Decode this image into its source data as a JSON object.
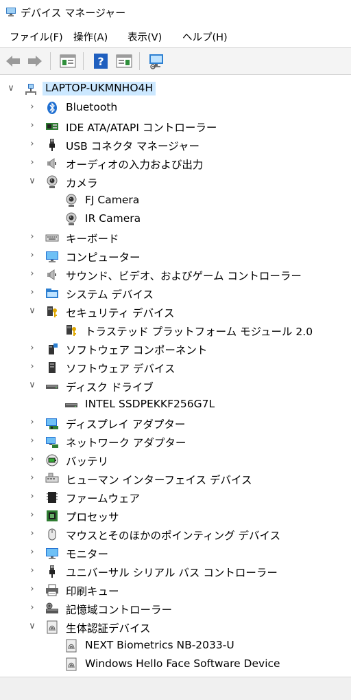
{
  "window": {
    "title": "デバイス マネージャー"
  },
  "menu": [
    {
      "label": "ファイル(F)"
    },
    {
      "label": "操作(A)"
    },
    {
      "label": "表示(V)"
    },
    {
      "label": "ヘルプ(H)"
    }
  ],
  "toolbar": [
    {
      "name": "back-button",
      "icon": "back-arrow-icon"
    },
    {
      "name": "forward-button",
      "icon": "forward-arrow-icon"
    },
    {
      "name": "show-hide-console-tree-button",
      "icon": "console-tree-icon"
    },
    {
      "name": "help-button",
      "icon": "help-icon"
    },
    {
      "name": "show-action-pane-button",
      "icon": "action-pane-icon"
    },
    {
      "name": "scan-hardware-button",
      "icon": "monitor-scan-icon"
    }
  ],
  "tree": {
    "root": {
      "label": "LAPTOP-UKMNHO4H",
      "icon": "computer-network-icon"
    },
    "items": [
      {
        "label": "Bluetooth",
        "icon": "bluetooth-icon",
        "expanded": false,
        "level": 1
      },
      {
        "label": "IDE ATA/ATAPI コントローラー",
        "icon": "ide-controller-icon",
        "expanded": false,
        "level": 1
      },
      {
        "label": "USB コネクタ マネージャー",
        "icon": "usb-plug-icon",
        "expanded": false,
        "level": 1
      },
      {
        "label": "オーディオの入力および出力",
        "icon": "speaker-icon",
        "expanded": false,
        "level": 1
      },
      {
        "label": "カメラ",
        "icon": "webcam-icon",
        "expanded": true,
        "level": 1
      },
      {
        "label": "FJ Camera",
        "icon": "webcam-icon",
        "level": 2
      },
      {
        "label": "IR Camera",
        "icon": "webcam-icon",
        "level": 2
      },
      {
        "label": "キーボード",
        "icon": "keyboard-icon",
        "expanded": false,
        "level": 1
      },
      {
        "label": "コンピューター",
        "icon": "monitor-icon",
        "expanded": false,
        "level": 1
      },
      {
        "label": "サウンド、ビデオ、およびゲーム コントローラー",
        "icon": "speaker-icon",
        "expanded": false,
        "level": 1
      },
      {
        "label": "システム デバイス",
        "icon": "system-folder-icon",
        "expanded": false,
        "level": 1
      },
      {
        "label": "セキュリティ デバイス",
        "icon": "security-key-icon",
        "expanded": true,
        "level": 1
      },
      {
        "label": "トラステッド プラットフォーム モジュール 2.0",
        "icon": "security-key-icon",
        "level": 2
      },
      {
        "label": "ソフトウェア コンポーネント",
        "icon": "software-component-icon",
        "expanded": false,
        "level": 1
      },
      {
        "label": "ソフトウェア デバイス",
        "icon": "software-device-icon",
        "expanded": false,
        "level": 1
      },
      {
        "label": "ディスク ドライブ",
        "icon": "disk-drive-icon",
        "expanded": true,
        "level": 1
      },
      {
        "label": "INTEL SSDPEKKF256G7L",
        "icon": "disk-drive-icon",
        "level": 2
      },
      {
        "label": "ディスプレイ アダプター",
        "icon": "display-adapter-icon",
        "expanded": false,
        "level": 1
      },
      {
        "label": "ネットワーク アダプター",
        "icon": "network-adapter-icon",
        "expanded": false,
        "level": 1
      },
      {
        "label": "バッテリ",
        "icon": "battery-icon",
        "expanded": false,
        "level": 1
      },
      {
        "label": "ヒューマン インターフェイス デバイス",
        "icon": "hid-icon",
        "expanded": false,
        "level": 1
      },
      {
        "label": "ファームウェア",
        "icon": "firmware-chip-icon",
        "expanded": false,
        "level": 1
      },
      {
        "label": "プロセッサ",
        "icon": "processor-icon",
        "expanded": false,
        "level": 1
      },
      {
        "label": "マウスとそのほかのポインティング デバイス",
        "icon": "mouse-icon",
        "expanded": false,
        "level": 1
      },
      {
        "label": "モニター",
        "icon": "monitor-icon",
        "expanded": false,
        "level": 1
      },
      {
        "label": "ユニバーサル シリアル バス コントローラー",
        "icon": "usb-plug-icon",
        "expanded": false,
        "level": 1
      },
      {
        "label": "印刷キュー",
        "icon": "printer-icon",
        "expanded": false,
        "level": 1
      },
      {
        "label": "記憶域コントローラー",
        "icon": "storage-controller-icon",
        "expanded": false,
        "level": 1
      },
      {
        "label": "生体認証デバイス",
        "icon": "fingerprint-icon",
        "expanded": true,
        "level": 1
      },
      {
        "label": "NEXT Biometrics NB-2033-U",
        "icon": "fingerprint-icon",
        "level": 2
      },
      {
        "label": "Windows Hello Face Software Device",
        "icon": "fingerprint-icon",
        "level": 2
      }
    ]
  }
}
